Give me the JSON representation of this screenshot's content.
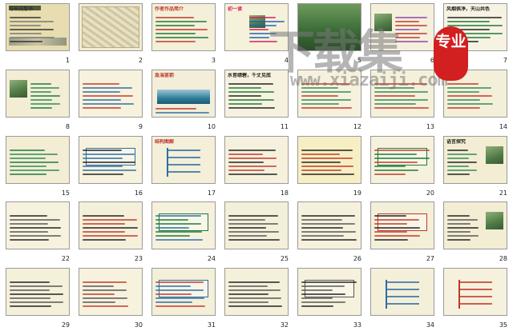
{
  "slides": [
    {
      "n": "1",
      "title": "与朱元思书",
      "bg": "#e8ddb0",
      "ink": "#333333",
      "line": "#777777",
      "art": "banner"
    },
    {
      "n": "2",
      "title": "",
      "bg": "#f2ecd3",
      "ink": "#333333",
      "line": "#777777",
      "art": "map"
    },
    {
      "n": "3",
      "title": "作者作品简介",
      "bg": "#f4efd8",
      "ink": "#c0392b",
      "line": "#1b7a3a",
      "art": "none"
    },
    {
      "n": "4",
      "title": "初一读",
      "bg": "#f6f1da",
      "ink": "#d81b60",
      "line": "#1e63b8",
      "art": "photo-small"
    },
    {
      "n": "5",
      "title": "",
      "bg": "#2f6b34",
      "ink": "#ffffff",
      "line": "#ffffff",
      "art": "photo-full"
    },
    {
      "n": "6",
      "title": "",
      "bg": "#f5f0dc",
      "ink": "#8e44ad",
      "line": "#c0392b",
      "art": "photo-left"
    },
    {
      "n": "7",
      "title": "风烟俱净，天山共色",
      "bg": "#f7f3e3",
      "ink": "#222222",
      "line": "#1b7a3a",
      "art": "none"
    },
    {
      "n": "8",
      "title": "",
      "bg": "#f3edd4",
      "ink": "#1b7a3a",
      "line": "#2e8b57",
      "art": "photo-left"
    },
    {
      "n": "9",
      "title": "",
      "bg": "#f6f2de",
      "ink": "#c0392b",
      "line": "#2e6da4",
      "art": "none"
    },
    {
      "n": "10",
      "title": "急湍甚箭",
      "bg": "#f3eed9",
      "ink": "#c0392b",
      "line": "#2e6da4",
      "art": "sea"
    },
    {
      "n": "11",
      "title": "水皆缥碧，千丈见底",
      "bg": "#f7f2df",
      "ink": "#222222",
      "line": "#1b7a3a",
      "art": "none"
    },
    {
      "n": "12",
      "title": "",
      "bg": "#f6f1dd",
      "ink": "#c0392b",
      "line": "#2e8b57",
      "art": "none"
    },
    {
      "n": "13",
      "title": "",
      "bg": "#f5f0da",
      "ink": "#c0392b",
      "line": "#2e8b57",
      "art": "none"
    },
    {
      "n": "14",
      "title": "",
      "bg": "#f4efd9",
      "ink": "#c0392b",
      "line": "#2e8b57",
      "art": "none"
    },
    {
      "n": "15",
      "title": "",
      "bg": "#f3edd3",
      "ink": "#1b7a3a",
      "line": "#2e8b57",
      "art": "none"
    },
    {
      "n": "16",
      "title": "",
      "bg": "#f6f2de",
      "ink": "#222222",
      "line": "#2e6da4",
      "art": "box"
    },
    {
      "n": "17",
      "title": "结构图解",
      "bg": "#f4efd9",
      "ink": "#c0392b",
      "line": "#2e6da4",
      "art": "tree"
    },
    {
      "n": "18",
      "title": "",
      "bg": "#f5f1dd",
      "ink": "#222222",
      "line": "#c0392b",
      "art": "none"
    },
    {
      "n": "19",
      "title": "",
      "bg": "#f7efc3",
      "ink": "#222222",
      "line": "#c0392b",
      "art": "none"
    },
    {
      "n": "20",
      "title": "",
      "bg": "#f6f1dc",
      "ink": "#c0392b",
      "line": "#1b7a3a",
      "art": "box"
    },
    {
      "n": "21",
      "title": "语言探究",
      "bg": "#f3edd3",
      "ink": "#222222",
      "line": "#2e8b57",
      "art": "photo-right"
    },
    {
      "n": "22",
      "title": "",
      "bg": "#f6f2de",
      "ink": "#222222",
      "line": "#555555",
      "art": "none"
    },
    {
      "n": "23",
      "title": "",
      "bg": "#f5f0da",
      "ink": "#222222",
      "line": "#c0392b",
      "art": "none"
    },
    {
      "n": "24",
      "title": "",
      "bg": "#f6f1dd",
      "ink": "#2e6da4",
      "line": "#1b7a3a",
      "art": "box"
    },
    {
      "n": "25",
      "title": "",
      "bg": "#f4efd9",
      "ink": "#222222",
      "line": "#555555",
      "art": "none"
    },
    {
      "n": "26",
      "title": "",
      "bg": "#f5f1dd",
      "ink": "#222222",
      "line": "#555555",
      "art": "none"
    },
    {
      "n": "27",
      "title": "",
      "bg": "#f4efd9",
      "ink": "#222222",
      "line": "#c0392b",
      "art": "box"
    },
    {
      "n": "28",
      "title": "",
      "bg": "#f3edd4",
      "ink": "#222222",
      "line": "#555555",
      "art": "photo-right"
    },
    {
      "n": "29",
      "title": "",
      "bg": "#f5f0da",
      "ink": "#222222",
      "line": "#555555",
      "art": "none"
    },
    {
      "n": "30",
      "title": "",
      "bg": "#f6f2de",
      "ink": "#c0392b",
      "line": "#555555",
      "art": "none"
    },
    {
      "n": "31",
      "title": "",
      "bg": "#f4efd9",
      "ink": "#c0392b",
      "line": "#2e6da4",
      "art": "box"
    },
    {
      "n": "32",
      "title": "",
      "bg": "#f5f0da",
      "ink": "#222222",
      "line": "#555555",
      "art": "none"
    },
    {
      "n": "33",
      "title": "",
      "bg": "#f6f1dc",
      "ink": "#222222",
      "line": "#555555",
      "art": "box"
    },
    {
      "n": "34",
      "title": "",
      "bg": "#f4efd9",
      "ink": "#222222",
      "line": "#2e6da4",
      "art": "tree"
    },
    {
      "n": "35",
      "title": "",
      "bg": "#f6f1dd",
      "ink": "#222222",
      "line": "#c0392b",
      "art": "tree"
    }
  ],
  "watermark": {
    "text": "下载集",
    "url": "www.xiazaiji.com",
    "badge": "专业"
  }
}
